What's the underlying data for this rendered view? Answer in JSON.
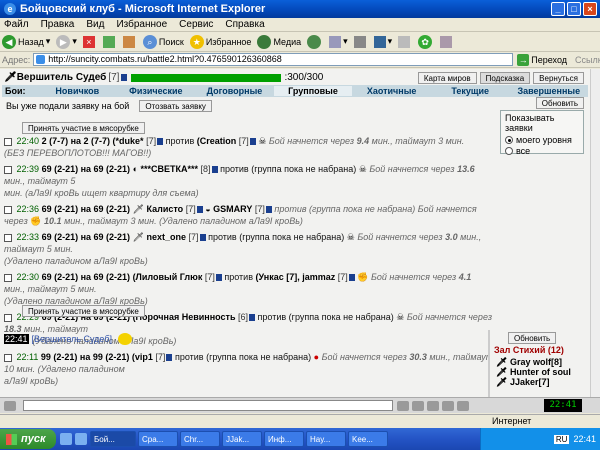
{
  "window": {
    "title": "Бойцовский клуб - Microsoft Internet Explorer"
  },
  "menu": [
    "Файл",
    "Правка",
    "Вид",
    "Избранное",
    "Сервис",
    "Справка"
  ],
  "toolbar": {
    "back": "Назад",
    "search": "Поиск",
    "favorites": "Избранное",
    "media": "Медиа"
  },
  "address": {
    "label": "Адрес:",
    "url": "http://suncity.combats.ru/battle2.html?0.476590126360868",
    "go": "Переход",
    "links": "Ссылки"
  },
  "player": {
    "name": "Вершитель Судеб",
    "level": "[7]",
    "hp": ":300/300"
  },
  "top_buttons": [
    "Карта миров",
    "Подсказка",
    "Вернуться"
  ],
  "tabs": {
    "first": "Бои:",
    "items": [
      "Новичков",
      "Физические",
      "Договорные",
      "Групповые",
      "Хаотичные",
      "Текущие",
      "Завершенные"
    ],
    "selected": 3
  },
  "submitted": {
    "text": "Вы уже подали заявку на бой",
    "button": "Отозвать заявку"
  },
  "refresh": "Обновить",
  "show": {
    "title": "Показывать заявки",
    "opt1": "моего уровня",
    "opt2": "все",
    "selected": 0
  },
  "join": "Принять участие в мясорубке",
  "rows": [
    {
      "time": "22:40",
      "lvl": "2 (7-7) на 2 (7-7)",
      "a": "(*duke*",
      "al": "[7]",
      "vs": "против",
      "b": "(Creation",
      "bl": "[7]",
      "tail": "Бой начнется через",
      "mins": "9.4",
      "rest": "мин., таймаут 3 мин.",
      "extra": "(БЕЗ ПЕРЕВОПЛОТОВ!!! МАГОВ!!)"
    },
    {
      "time": "22:39",
      "lvl": "69 (2-21) на 69 (2-21)",
      "a": "***СВЕТКА***",
      "al": "[8]",
      "vs": "против",
      "b": "(группа пока не набрана)",
      "bl": "",
      "tail": "Бой начнется через",
      "mins": "13.6",
      "rest": "мин., таймаут 5",
      "extra": "мин. (аЛа9I кроВь ищет квартиру для съема)"
    },
    {
      "time": "22:36",
      "lvl": "69 (2-21) на 69 (2-21)",
      "a": "Калисто",
      "al": "[7]",
      "vs": "",
      "b": "GSMARY",
      "bl": "[7]",
      "tail": "против (группа пока не набрана) Бой начнется через",
      "mins": "10.1",
      "rest": "мин., таймаут 3 мин. (Удалено паладином",
      "extra": "аЛа9I кроВь)"
    },
    {
      "time": "22:33",
      "lvl": "69 (2-21) на 69 (2-21)",
      "a": "next_one",
      "al": "[7]",
      "vs": "против",
      "b": "(группа пока не набрана)",
      "bl": "",
      "tail": "Бой начнется через",
      "mins": "3.0",
      "rest": "мин., таймаут 5 мин.",
      "extra": "(Удалено паладином аЛа9I кроВь)"
    },
    {
      "time": "22:30",
      "lvl": "69 (2-21) на 69 (2-21)",
      "a": "(Лиловый Глюк",
      "al": "[7]",
      "vs": "против",
      "b": "(Ункас [7], jammaz",
      "bl": "[7]",
      "tail": "Бой начнется через",
      "mins": "4.1",
      "rest": "мин., таймаут 5 мин.",
      "extra": "(Удалено паладином аЛа9I кроВь)"
    },
    {
      "time": "22:29",
      "lvl": "69 (2-21) на 69 (2-21)",
      "a": "(Порочная Невинность",
      "al": "[6]",
      "vs": "против",
      "b": "(группа пока не набрана)",
      "bl": "",
      "tail": "Бой начнется через",
      "mins": "18.3",
      "rest": "мин., таймаут",
      "extra": "5 мин. (Удалено паладином аЛа9I кроВь)"
    },
    {
      "time": "22:11",
      "lvl": "99 (2-21) на 99 (2-21)",
      "a": "(vip1",
      "al": "[7]",
      "vs": "против",
      "b": "(группа пока не набрана)",
      "bl": "",
      "tail": "Бой начнется через",
      "mins": "30.3",
      "rest": "мин., таймаут 10 мин. (Удалено паладином",
      "extra": "аЛа9I кроВь)"
    }
  ],
  "chat": {
    "time": "22:41",
    "name": "[Вершитель Судеб]"
  },
  "side": {
    "refresh": "Обновить",
    "hall": "Зал Стихий (12)",
    "players": [
      "Gray wolf[8]",
      "Hunter of soul",
      "JJaker[7]"
    ]
  },
  "clock": "22:41",
  "status": {
    "net": "Интернет"
  },
  "taskbar": {
    "start": "пуск",
    "tasks": [
      "Бой...",
      "Сра...",
      "Chr...",
      "JJak...",
      "Инф...",
      "Hay...",
      "Kee...",
      "~W...",
      "Ada..."
    ],
    "lang": "RU",
    "time": "22:41"
  }
}
